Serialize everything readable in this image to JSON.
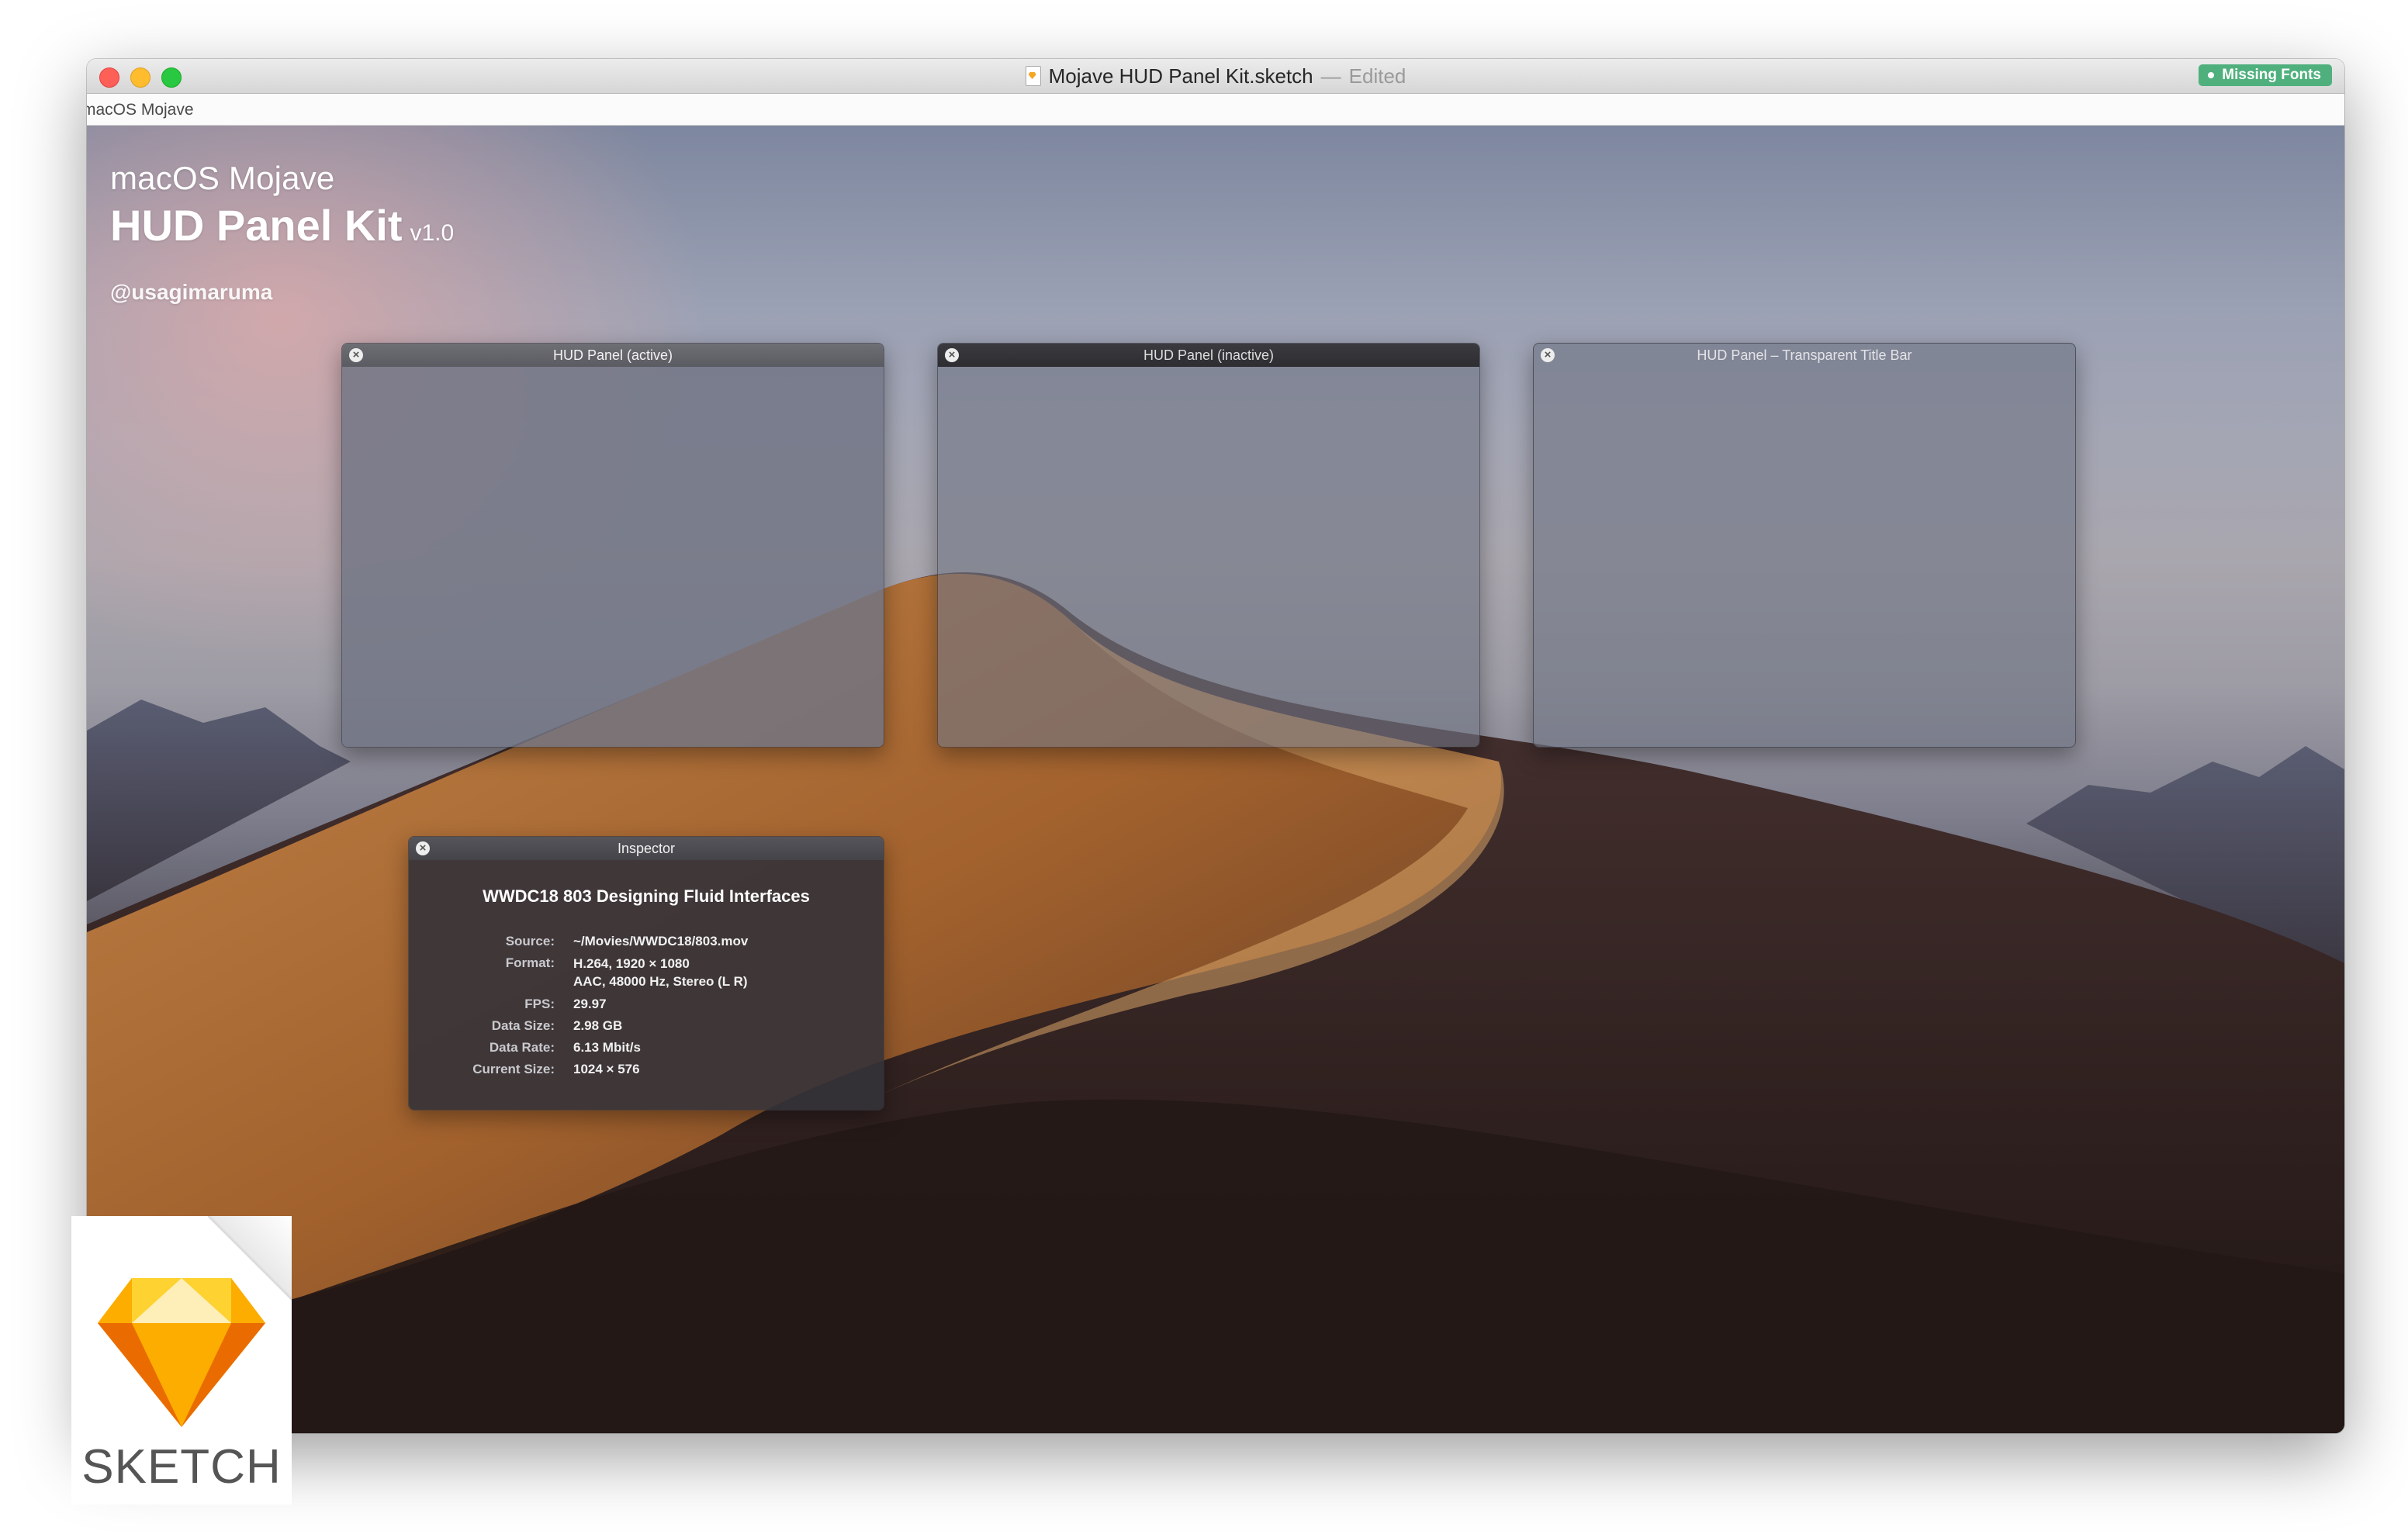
{
  "window": {
    "title": "Mojave HUD Panel Kit.sketch",
    "title_separator": "—",
    "title_status": "Edited",
    "missing_fonts_badge": "Missing Fonts",
    "artboard_label": "macOS Mojave"
  },
  "headline": {
    "subtitle": "macOS Mojave",
    "title": "HUD Panel Kit",
    "version": "v1.0",
    "handle": "@usagimaruma"
  },
  "panels": [
    {
      "title": "HUD Panel (active)"
    },
    {
      "title": "HUD Panel (inactive)"
    },
    {
      "title": "HUD Panel – Transparent Title Bar"
    }
  ],
  "inspector": {
    "window_title": "Inspector",
    "media_title": "WWDC18 803 Designing Fluid Interfaces",
    "rows": [
      {
        "label": "Source:",
        "value": "~/Movies/WWDC18/803.mov"
      },
      {
        "label": "Format:",
        "value": "H.264, 1920 × 1080",
        "value2": "AAC, 48000 Hz, Stereo (L R)"
      },
      {
        "label": "FPS:",
        "value": "29.97"
      },
      {
        "label": "Data Size:",
        "value": "2.98 GB"
      },
      {
        "label": "Data Rate:",
        "value": "6.13 Mbit/s"
      },
      {
        "label": "Current Size:",
        "value": "1024 × 576"
      }
    ]
  },
  "badge": {
    "label": "SKETCH",
    "icon": "sketch-diamond-icon"
  },
  "colors": {
    "missing_fonts_green": "#4fb07d",
    "close_red": "#fe5f57",
    "minimize_yellow": "#febc2e",
    "zoom_green": "#28c840"
  }
}
